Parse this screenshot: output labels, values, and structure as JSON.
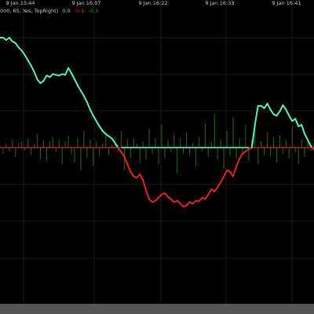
{
  "chart_data": {
    "type": "line",
    "indicator_label": "000, 65, Yes, TopRight)",
    "legend_values": [
      {
        "text": "0.0",
        "color": "#5cf2b4"
      },
      {
        "text": "-0.1",
        "color": "#e23030"
      },
      {
        "text": "-0.3",
        "color": "#2e9e2e"
      }
    ],
    "x_tick_labels": [
      "9 Jan 15:44",
      "9 Jan 16:07",
      "9 Jan 16:22",
      "9 Jan 16:33",
      "9 Jan 16:41"
    ],
    "ylim": [
      -1.05,
      1.45
    ],
    "grid": true,
    "colors": {
      "background": "#000000",
      "grid": "#1c1c1c",
      "positive_line": "#5cf2b4",
      "negative_line": "#e0262a",
      "histogram": "#1f5a1f",
      "bottom_bar": "#555555"
    },
    "series": [
      {
        "values": [
          1.45,
          1.45,
          1.42,
          1.45,
          1.4,
          1.38,
          1.32,
          1.28,
          1.22,
          1.15,
          1.08,
          1.0,
          0.9,
          0.85,
          0.88,
          0.95,
          0.93,
          0.97,
          0.96,
          0.95,
          0.97,
          0.96,
          1.05,
          0.98,
          0.9,
          0.82,
          0.75,
          0.68,
          0.6,
          0.5,
          0.42,
          0.35,
          0.28,
          0.22,
          0.18,
          0.15,
          0.12,
          0.06,
          0.0,
          -0.06,
          -0.12,
          -0.22,
          -0.32,
          -0.38,
          -0.4,
          -0.35,
          -0.43,
          -0.57,
          -0.68,
          -0.72,
          -0.7,
          -0.66,
          -0.62,
          -0.6,
          -0.65,
          -0.68,
          -0.72,
          -0.7,
          -0.74,
          -0.78,
          -0.76,
          -0.72,
          -0.74,
          -0.7,
          -0.71,
          -0.66,
          -0.68,
          -0.62,
          -0.55,
          -0.58,
          -0.52,
          -0.46,
          -0.38,
          -0.3,
          -0.32,
          -0.38,
          -0.25,
          -0.15,
          -0.08,
          -0.05,
          -0.02,
          0.0,
          0.3,
          0.55,
          0.55,
          0.52,
          0.58,
          0.5,
          0.44,
          0.42,
          0.48,
          0.56,
          0.5,
          0.42,
          0.35,
          0.38,
          0.28,
          0.3,
          0.18,
          0.1,
          0.02,
          -0.03
        ]
      }
    ],
    "histogram": [
      0.02,
      -0.08,
      0.05,
      -0.05,
      0.1,
      -0.12,
      0.06,
      0.08,
      -0.04,
      0.12,
      -0.1,
      0.05,
      0.18,
      -0.15,
      0.1,
      -0.18,
      0.08,
      0.14,
      -0.06,
      0.1,
      -0.22,
      0.09,
      0.16,
      -0.08,
      -0.2,
      0.12,
      -0.3,
      0.22,
      -0.14,
      0.1,
      -0.24,
      0.08,
      -0.12,
      0.05,
      0.2,
      -0.1,
      0.04,
      0.15,
      -0.06,
      0.22,
      -0.3,
      0.1,
      -0.14,
      0.12,
      0.05,
      -0.2,
      0.08,
      -0.16,
      0.25,
      -0.08,
      0.12,
      -0.22,
      0.3,
      -0.14,
      0.1,
      -0.06,
      0.18,
      -0.34,
      0.12,
      -0.08,
      0.2,
      -0.1,
      0.06,
      -0.24,
      0.14,
      -0.05,
      0.32,
      -0.12,
      0.08,
      0.44,
      -0.16,
      0.1,
      -0.28,
      0.22,
      -0.1,
      0.4,
      -0.14,
      0.12,
      -0.08,
      0.3,
      -0.18,
      0.1,
      0.26,
      -0.22,
      0.08,
      -0.1,
      0.2,
      -0.12,
      0.14,
      -0.2,
      0.16,
      -0.08,
      0.1,
      -0.14,
      0.28,
      -0.06,
      -0.22,
      0.1,
      -0.12,
      0.08,
      -0.04,
      0.06
    ]
  }
}
